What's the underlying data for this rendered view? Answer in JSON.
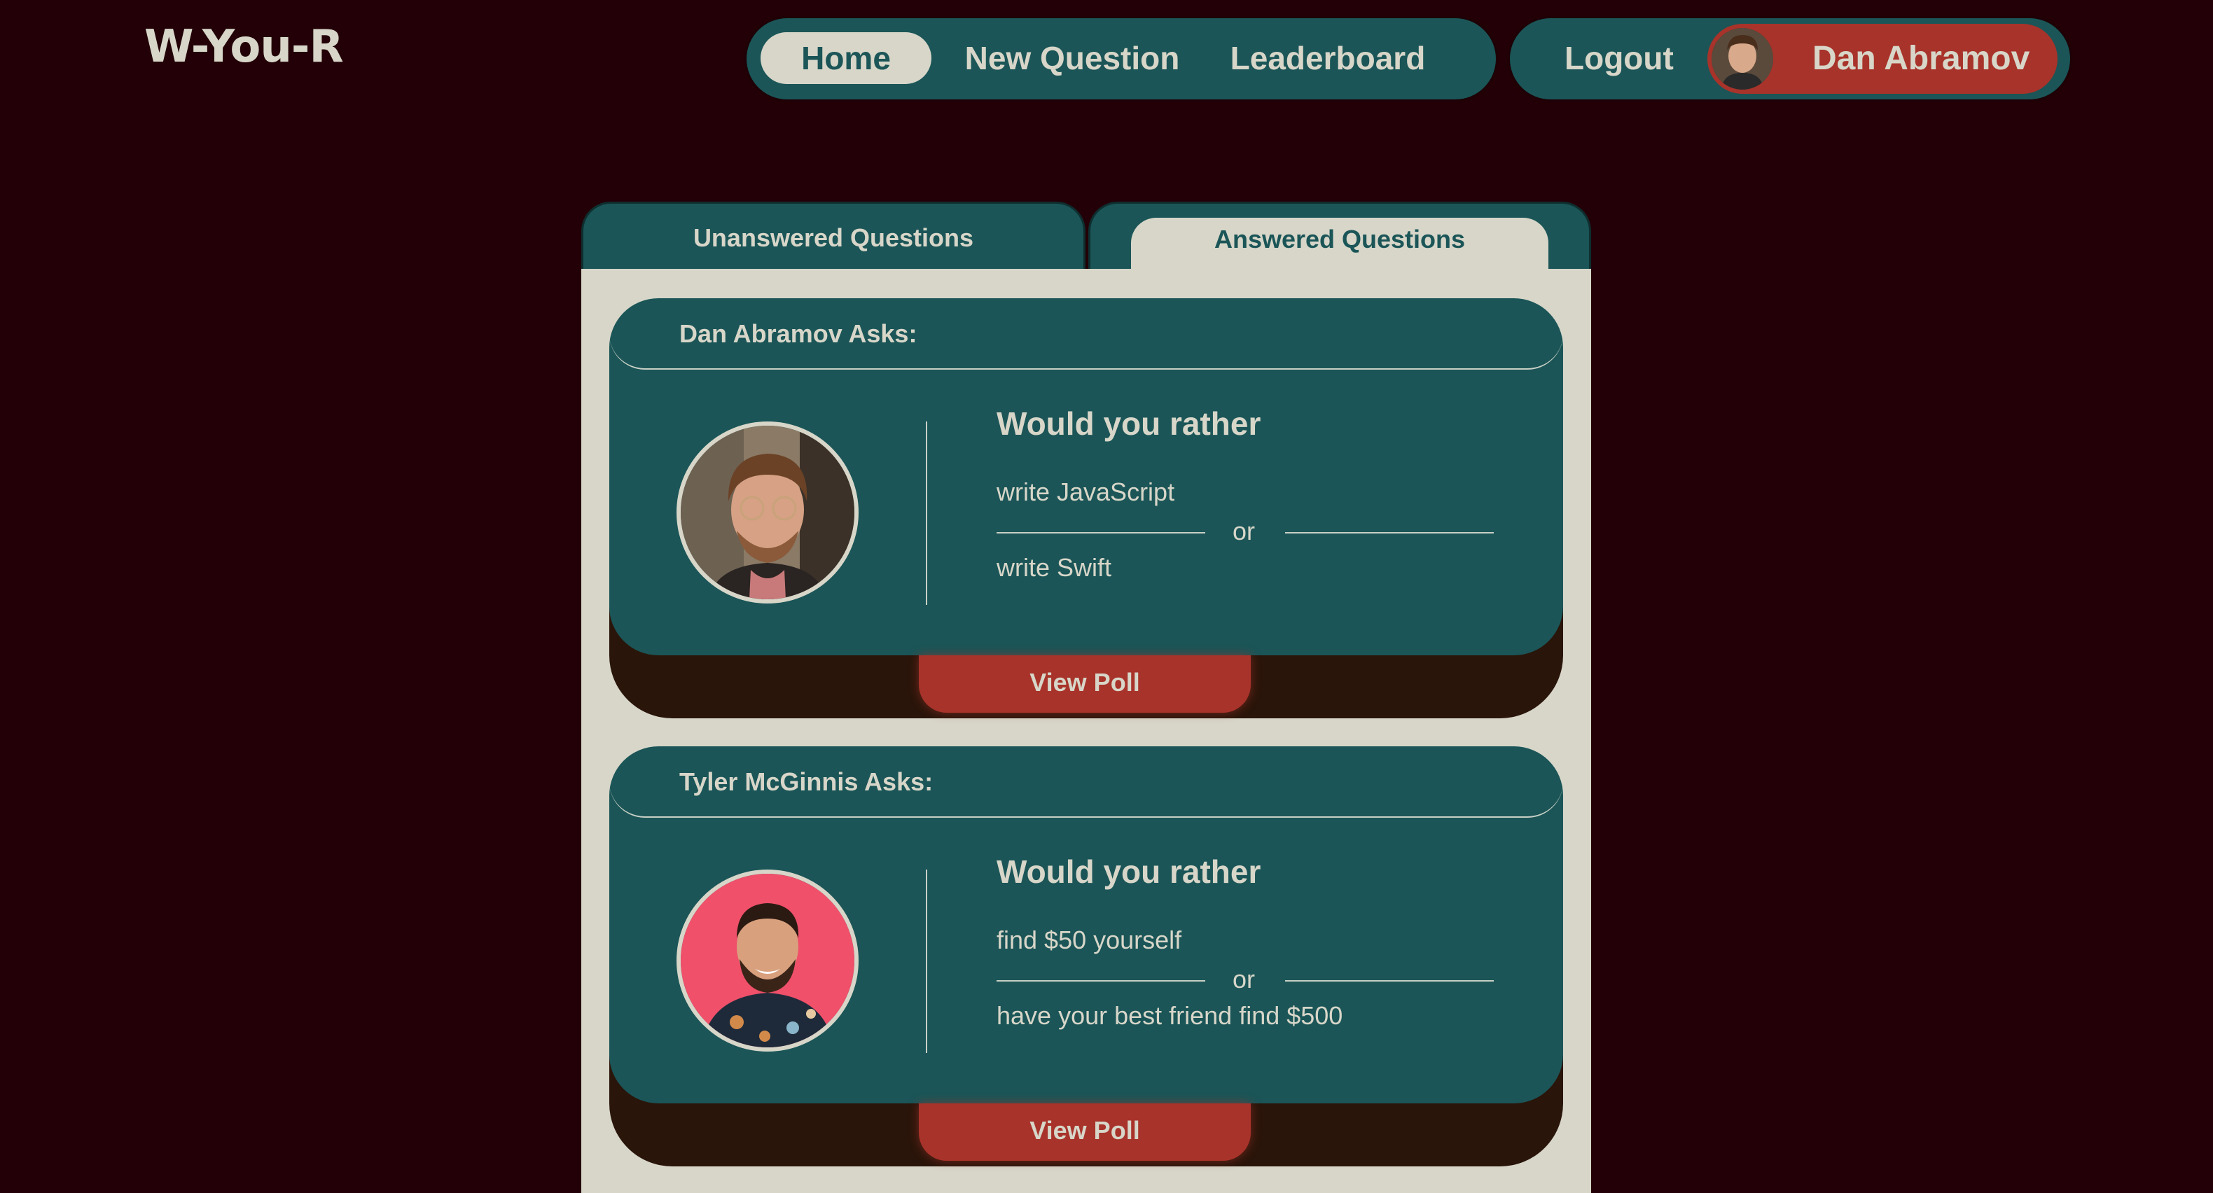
{
  "app": {
    "logo": "W-You-R"
  },
  "nav": {
    "items": [
      {
        "label": "Home",
        "active": true
      },
      {
        "label": "New Question",
        "active": false
      },
      {
        "label": "Leaderboard",
        "active": false
      }
    ],
    "logout_label": "Logout",
    "user_name": "Dan Abramov"
  },
  "tabs": [
    {
      "label": "Unanswered Questions",
      "active": false
    },
    {
      "label": "Answered Questions",
      "active": true
    }
  ],
  "questions": [
    {
      "author_header": "Dan Abramov Asks:",
      "prompt": "Would you rather",
      "option_one": "write JavaScript",
      "separator": "or",
      "option_two": "write Swift",
      "button_label": "View Poll"
    },
    {
      "author_header": "Tyler McGinnis Asks:",
      "prompt": "Would you rather",
      "option_one": "find $50 yourself",
      "separator": "or",
      "option_two": "have your best friend find $500",
      "button_label": "View Poll"
    }
  ],
  "colors": {
    "background": "#230007",
    "teal": "#1b5557",
    "cream": "#d7d6c9",
    "accent_red": "#a8332a",
    "card_shadow": "#2a150a"
  }
}
